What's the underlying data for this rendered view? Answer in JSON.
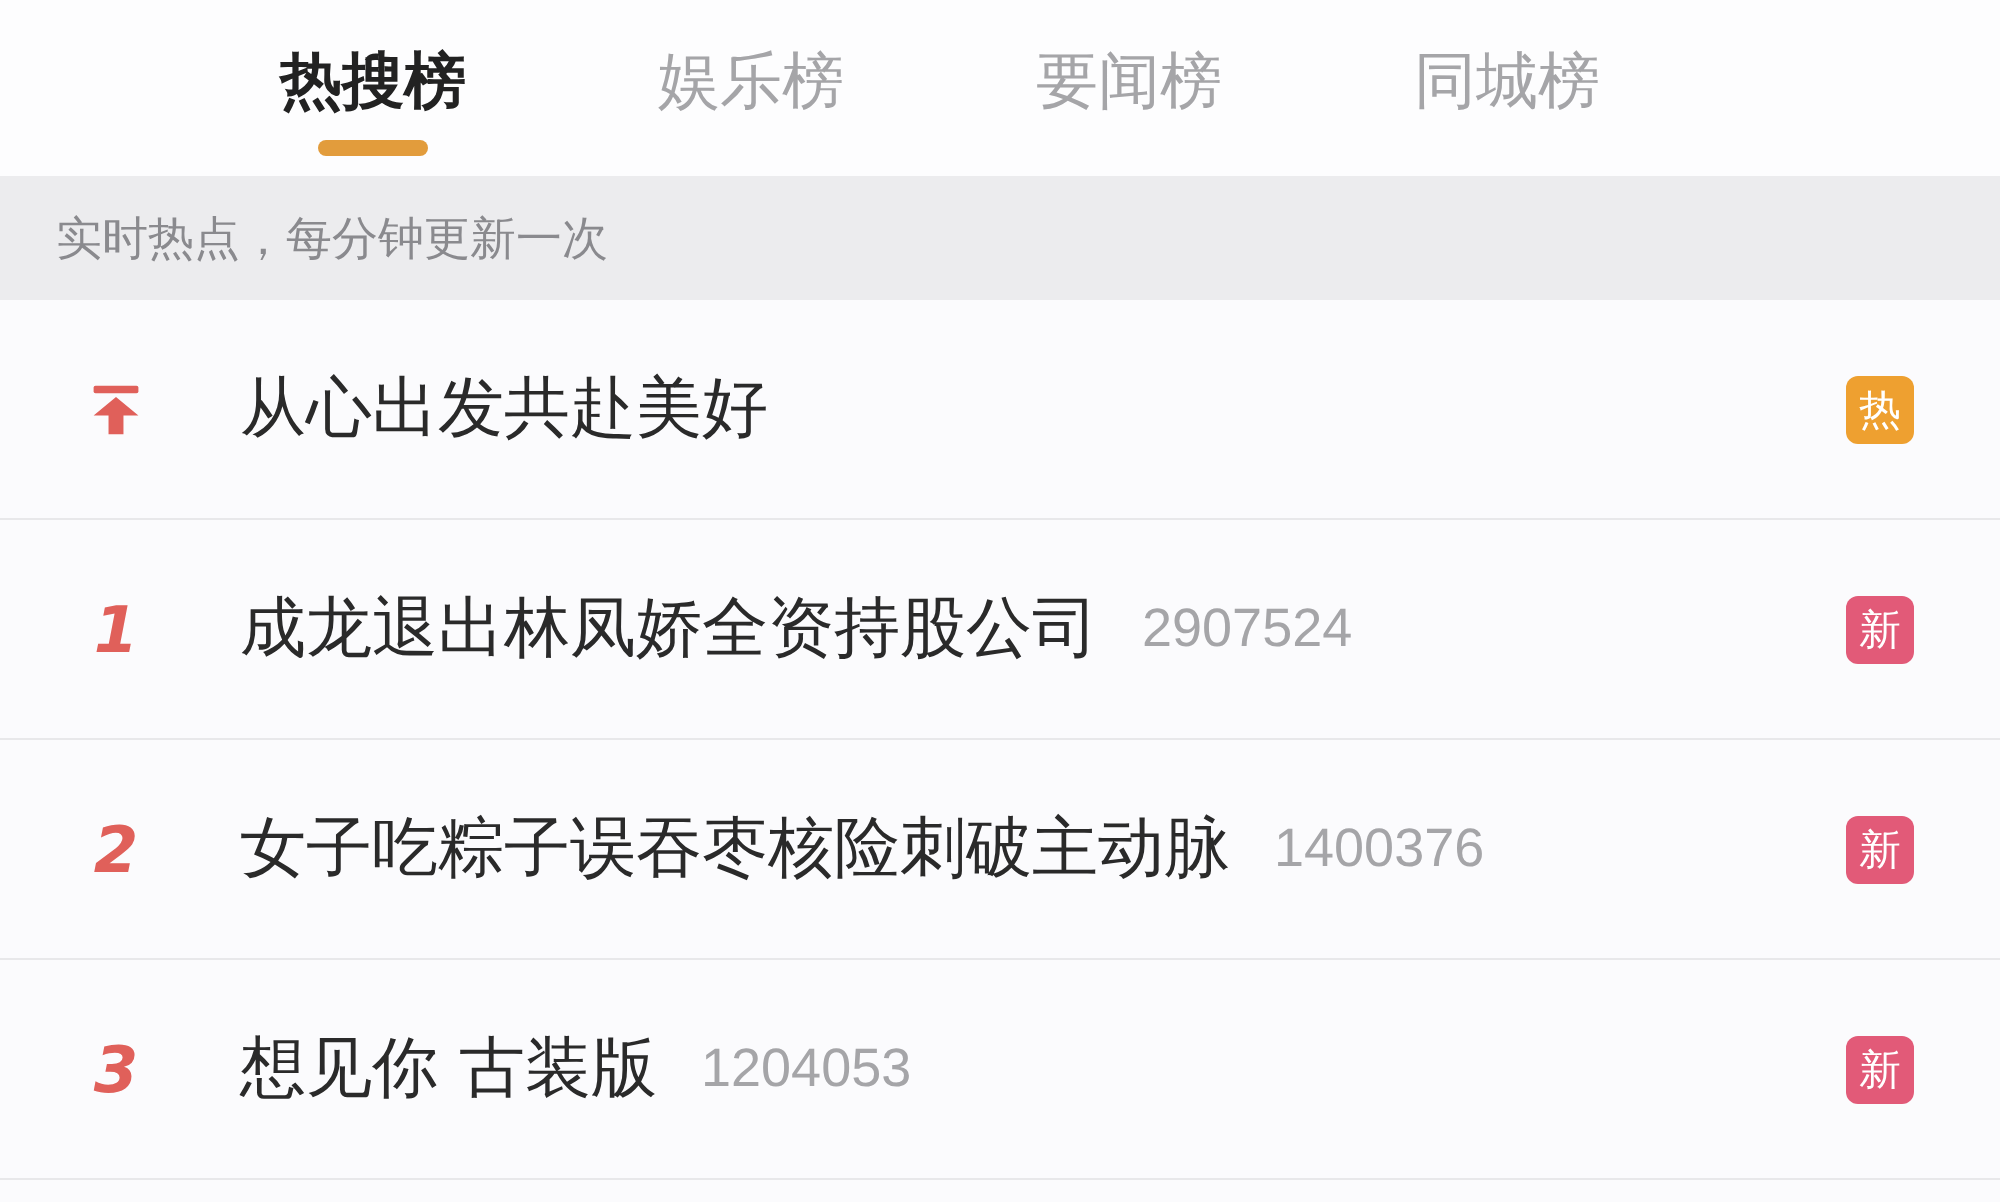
{
  "tabs": [
    {
      "label": "热搜榜",
      "selected": true
    },
    {
      "label": "娱乐榜",
      "selected": false
    },
    {
      "label": "要闻榜",
      "selected": false
    },
    {
      "label": "同城榜",
      "selected": false
    }
  ],
  "notice": "实时热点，每分钟更新一次",
  "items": [
    {
      "kind": "pinned",
      "title": "从心出发共赴美好",
      "badge": {
        "label": "热",
        "color": "#eea030"
      }
    },
    {
      "kind": "ranked",
      "rank": "1",
      "title": "成龙退出林凤娇全资持股公司",
      "count": "2907524",
      "badge": {
        "label": "新",
        "color": "#e25a78"
      }
    },
    {
      "kind": "ranked",
      "rank": "2",
      "title": "女子吃粽子误吞枣核险刺破主动脉",
      "count": "1400376",
      "badge": {
        "label": "新",
        "color": "#e25a78"
      }
    },
    {
      "kind": "ranked",
      "rank": "3",
      "title": "想见你 古装版",
      "count": "1204053",
      "badge": {
        "label": "新",
        "color": "#e25a78"
      }
    }
  ]
}
